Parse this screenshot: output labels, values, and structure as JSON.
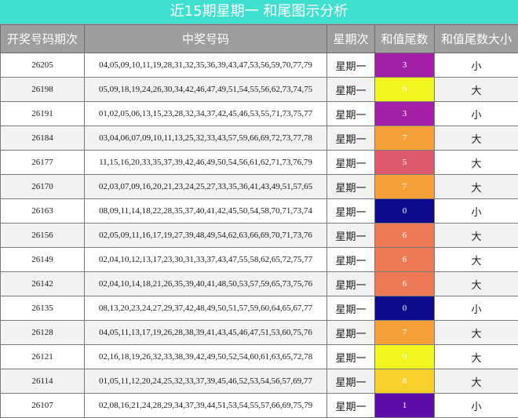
{
  "title": "近15期星期一 和尾图示分析",
  "headers": [
    "开奖号码期次",
    "中奖号码",
    "星期次",
    "和值尾数",
    "和值尾数大小"
  ],
  "rows": [
    {
      "issue": "26205",
      "numbers": "04,05,09,10,11,19,28,31,32,35,36,39,43,47,53,56,59,70,77,79",
      "weekday": "星期一",
      "tail": "3",
      "size": "小",
      "color": "#a31fa6"
    },
    {
      "issue": "26198",
      "numbers": "05,09,18,19,24,26,30,34,42,46,47,49,51,54,55,56,62,73,74,75",
      "weekday": "星期一",
      "tail": "9",
      "size": "大",
      "color": "#f0f520"
    },
    {
      "issue": "26191",
      "numbers": "01,02,05,06,13,15,23,28,32,34,37,42,45,46,53,55,71,73,75,77",
      "weekday": "星期一",
      "tail": "3",
      "size": "小",
      "color": "#a31fa6"
    },
    {
      "issue": "26184",
      "numbers": "03,04,06,07,09,10,11,13,25,32,33,43,57,59,66,69,72,73,77,78",
      "weekday": "星期一",
      "tail": "7",
      "size": "大",
      "color": "#f7a039"
    },
    {
      "issue": "26177",
      "numbers": "11,15,16,20,33,35,37,39,42,46,49,50,54,56,61,62,71,73,76,79",
      "weekday": "星期一",
      "tail": "5",
      "size": "大",
      "color": "#dc5a6c"
    },
    {
      "issue": "26170",
      "numbers": "02,03,07,09,16,20,21,23,24,25,27,33,35,36,41,43,49,51,57,65",
      "weekday": "星期一",
      "tail": "7",
      "size": "大",
      "color": "#f7a039"
    },
    {
      "issue": "26163",
      "numbers": "08,09,11,14,18,22,28,35,37,40,41,42,45,50,54,58,70,71,73,74",
      "weekday": "星期一",
      "tail": "0",
      "size": "小",
      "color": "#0e0a8c"
    },
    {
      "issue": "26156",
      "numbers": "02,05,09,11,16,17,19,27,39,48,49,54,62,63,66,69,70,71,73,76",
      "weekday": "星期一",
      "tail": "6",
      "size": "大",
      "color": "#ee7a55"
    },
    {
      "issue": "26149",
      "numbers": "02,04,10,12,13,17,23,30,31,33,37,43,47,55,58,62,65,72,75,77",
      "weekday": "星期一",
      "tail": "6",
      "size": "大",
      "color": "#ee7a55"
    },
    {
      "issue": "26142",
      "numbers": "02,04,10,14,18,21,26,35,39,40,41,48,50,53,57,59,65,73,75,76",
      "weekday": "星期一",
      "tail": "6",
      "size": "大",
      "color": "#ee7a55"
    },
    {
      "issue": "26135",
      "numbers": "08,13,20,23,24,27,29,37,42,48,49,50,51,57,59,60,64,65,67,77",
      "weekday": "星期一",
      "tail": "0",
      "size": "小",
      "color": "#0e0a8c"
    },
    {
      "issue": "26128",
      "numbers": "04,05,11,13,17,19,26,28,38,39,41,43,45,46,47,51,53,60,75,76",
      "weekday": "星期一",
      "tail": "7",
      "size": "大",
      "color": "#f7a039"
    },
    {
      "issue": "26121",
      "numbers": "02,16,18,19,26,32,33,38,39,42,49,50,52,54,60,61,63,65,72,78",
      "weekday": "星期一",
      "tail": "9",
      "size": "大",
      "color": "#f0f520"
    },
    {
      "issue": "26114",
      "numbers": "01,05,11,12,20,24,25,32,33,37,39,45,46,52,53,54,56,57,69,77",
      "weekday": "星期一",
      "tail": "8",
      "size": "大",
      "color": "#f9cf2a"
    },
    {
      "issue": "26107",
      "numbers": "02,08,16,21,24,28,29,34,37,39,44,51,53,54,55,57,66,69,75,79",
      "weekday": "星期一",
      "tail": "1",
      "size": "小",
      "color": "#5d0ea8"
    }
  ]
}
